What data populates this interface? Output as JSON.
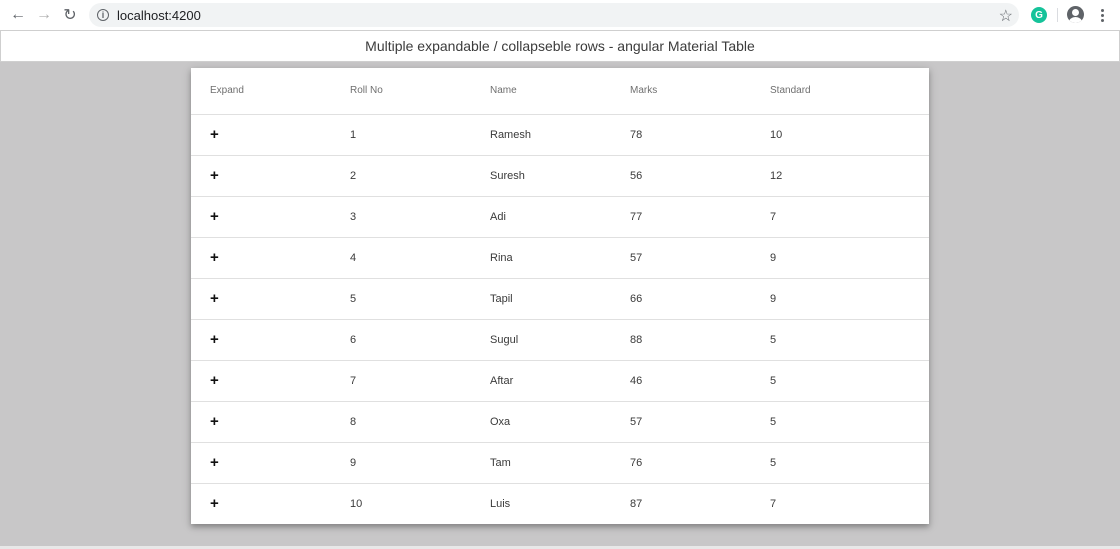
{
  "browser": {
    "back_icon": "arrow-left-icon",
    "forward_icon": "arrow-right-icon",
    "reload_icon": "reload-icon",
    "url": "localhost:4200",
    "extension_letter": "G"
  },
  "page": {
    "title": "Multiple expandable / collapseble rows - angular Material Table"
  },
  "table": {
    "headers": [
      "Expand",
      "Roll No",
      "Name",
      "Marks",
      "Standard"
    ],
    "expand_symbol": "+",
    "rows": [
      {
        "roll": "1",
        "name": "Ramesh",
        "marks": "78",
        "standard": "10"
      },
      {
        "roll": "2",
        "name": "Suresh",
        "marks": "56",
        "standard": "12"
      },
      {
        "roll": "3",
        "name": "Adi",
        "marks": "77",
        "standard": "7"
      },
      {
        "roll": "4",
        "name": "Rina",
        "marks": "57",
        "standard": "9"
      },
      {
        "roll": "5",
        "name": "Tapil",
        "marks": "66",
        "standard": "9"
      },
      {
        "roll": "6",
        "name": "Sugul",
        "marks": "88",
        "standard": "5"
      },
      {
        "roll": "7",
        "name": "Aftar",
        "marks": "46",
        "standard": "5"
      },
      {
        "roll": "8",
        "name": "Oxa",
        "marks": "57",
        "standard": "5"
      },
      {
        "roll": "9",
        "name": "Tam",
        "marks": "76",
        "standard": "5"
      },
      {
        "roll": "10",
        "name": "Luis",
        "marks": "87",
        "standard": "7"
      }
    ]
  }
}
